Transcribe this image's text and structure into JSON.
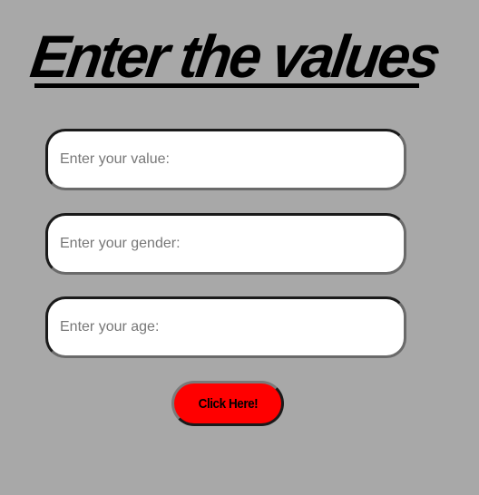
{
  "page": {
    "title": "Enter the values"
  },
  "form": {
    "value_placeholder": "Enter your value:",
    "gender_placeholder": "Enter your gender:",
    "age_placeholder": "Enter your age:",
    "submit_label": "Click Here!"
  },
  "colors": {
    "background": "#a8a8a8",
    "button": "#ff0000"
  }
}
